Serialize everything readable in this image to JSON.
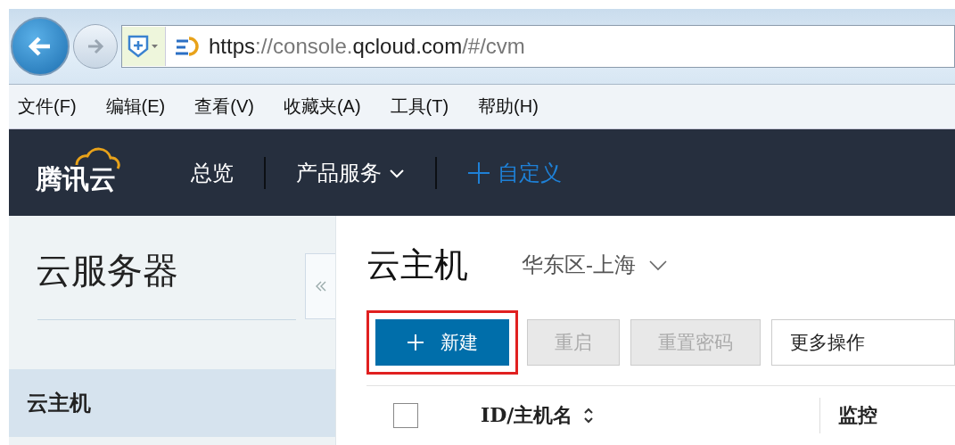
{
  "browser": {
    "url_parts": [
      {
        "text": "https",
        "emphasis": true
      },
      {
        "text": "://console.",
        "emphasis": false
      },
      {
        "text": "qcloud.com",
        "emphasis": true
      },
      {
        "text": "/#/cvm",
        "emphasis": false
      }
    ]
  },
  "menu_bar": [
    "文件(F)",
    "编辑(E)",
    "查看(V)",
    "收藏夹(A)",
    "工具(T)",
    "帮助(H)"
  ],
  "top_nav": {
    "logo": "腾讯云",
    "items": [
      {
        "label": "总览",
        "kind": "link"
      },
      {
        "label": "产品服务",
        "kind": "dropdown"
      },
      {
        "label": "自定义",
        "kind": "add"
      }
    ]
  },
  "sidebar": {
    "title": "云服务器",
    "items": [
      {
        "label": "云主机",
        "selected": true
      }
    ]
  },
  "page": {
    "title": "云主机",
    "region": "华东区-上海"
  },
  "toolbar": [
    {
      "label": "新建",
      "kind": "primary",
      "disabled": false,
      "highlighted": true
    },
    {
      "label": "重启",
      "kind": "default",
      "disabled": true,
      "highlighted": false
    },
    {
      "label": "重置密码",
      "kind": "default",
      "disabled": true,
      "highlighted": false
    },
    {
      "label": "更多操作",
      "kind": "select",
      "disabled": false,
      "highlighted": false
    }
  ],
  "table": {
    "select_all": {
      "checked": false
    },
    "columns": [
      {
        "label": "ID/主机名",
        "sortable": true
      },
      {
        "label": "监控",
        "sortable": false
      }
    ]
  }
}
